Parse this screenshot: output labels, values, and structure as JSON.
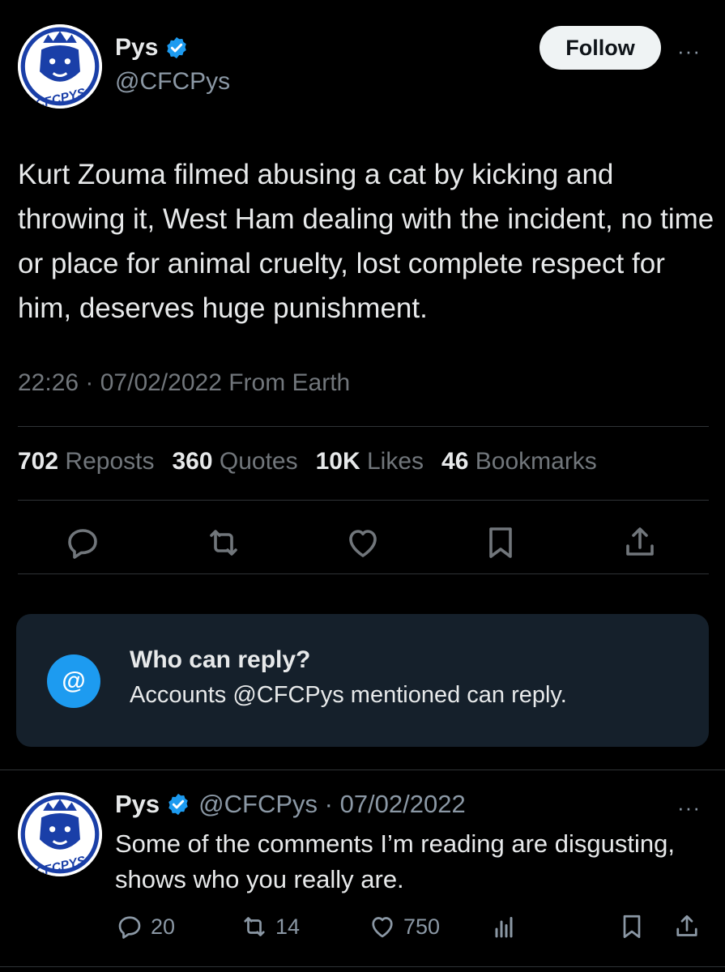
{
  "main_tweet": {
    "author": {
      "display_name": "Pys",
      "handle": "@CFCPys",
      "avatar_text": "CFCPYS",
      "verified_icon": "verified-badge-icon"
    },
    "follow_label": "Follow",
    "more_glyph": "···",
    "text": "Kurt Zouma filmed abusing a cat by kicking and throwing it, West Ham dealing with the incident, no time or place for animal cruelty, lost complete respect for him, deserves huge punishment.",
    "meta": "22:26 · 07/02/2022 From Earth",
    "stats": [
      {
        "count": "702",
        "label": "Reposts"
      },
      {
        "count": "360",
        "label": "Quotes"
      },
      {
        "count": "10K",
        "label": "Likes"
      },
      {
        "count": "46",
        "label": "Bookmarks"
      }
    ],
    "actions": [
      "reply-icon",
      "repost-icon",
      "like-icon",
      "bookmark-icon",
      "share-icon"
    ]
  },
  "reply_card": {
    "icon_text": "@",
    "title": "Who can reply?",
    "subtitle": "Accounts @CFCPys mentioned can reply."
  },
  "reply_tweet": {
    "display_name": "Pys",
    "handle_date": "@CFCPys · 07/02/2022",
    "more_glyph": "···",
    "text": "Some of the comments I’m reading are disgusting, shows who you really are.",
    "replies": "20",
    "reposts": "14",
    "likes": "750"
  },
  "colors": {
    "background": "#000000",
    "text": "#e7e9ea",
    "muted": "#71767b",
    "accent": "#1d9bf0",
    "card": "#15202b",
    "divider": "#2f3336",
    "avatar_blue": "#1a3fa8"
  }
}
